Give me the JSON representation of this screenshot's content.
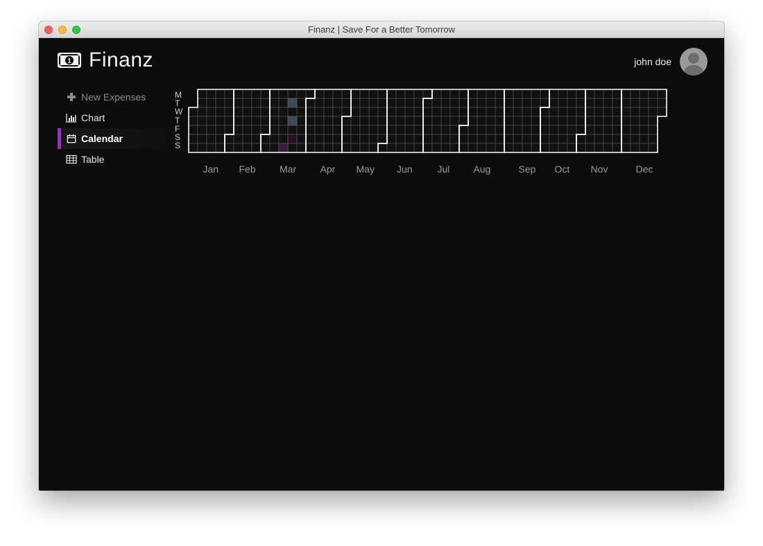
{
  "window": {
    "title": "Finanz | Save For a Better Tomorrow"
  },
  "brand": {
    "name": "Finanz",
    "icon": "banknote-icon"
  },
  "user": {
    "name": "john doe",
    "avatar_icon": "user-silhouette-icon"
  },
  "nav": {
    "items": [
      {
        "label": "New Expenses",
        "icon": "plus-icon",
        "state": "muted"
      },
      {
        "label": "Chart",
        "icon": "bar-chart-icon",
        "state": "normal"
      },
      {
        "label": "Calendar",
        "icon": "calendar-icon",
        "state": "active"
      },
      {
        "label": "Table",
        "icon": "table-icon",
        "state": "normal"
      }
    ]
  },
  "colors": {
    "active_accent": "#9b30c8",
    "highlight_day": "#3d4b58",
    "highlight_purple": "#3a1a3f"
  },
  "calendar": {
    "weekdays": [
      "M",
      "T",
      "W",
      "T",
      "F",
      "S",
      "S"
    ],
    "months": [
      "Jan",
      "Feb",
      "Mar",
      "Apr",
      "May",
      "Jun",
      "Jul",
      "Aug",
      "Sep",
      "Oct",
      "Nov",
      "Dec"
    ]
  }
}
